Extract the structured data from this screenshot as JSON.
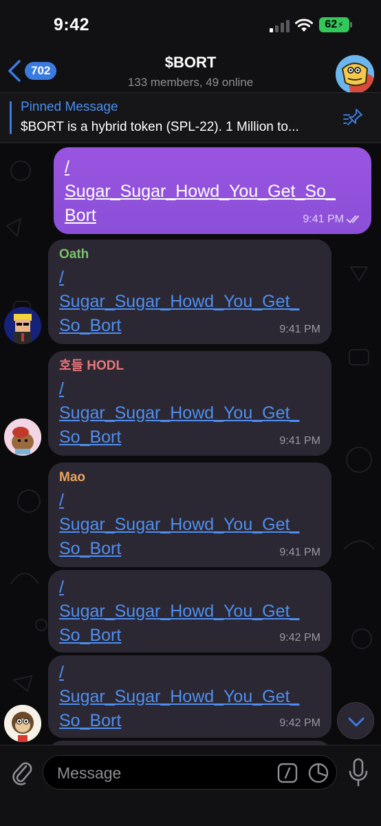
{
  "status_bar": {
    "time": "9:42",
    "battery": "62"
  },
  "header": {
    "back_count": "702",
    "title": "$BORT",
    "subtitle": "133 members, 49 online"
  },
  "pinned": {
    "title": "Pinned Message",
    "text": "$BORT is a hybrid token (SPL-22). 1 Million to..."
  },
  "messages": [
    {
      "direction": "outgoing",
      "sender": "",
      "text": "/\nSugar_Sugar_Howd_You_Get_So_\nBort",
      "time": "9:41 PM",
      "read": true
    },
    {
      "direction": "incoming",
      "sender": "Oath",
      "sender_color": "#7cc26a",
      "text": "/\nSugar_Sugar_Howd_You_Get_\nSo_Bort",
      "time": "9:41 PM"
    },
    {
      "direction": "incoming",
      "sender": "호들 HODL",
      "sender_color": "#e8767a",
      "text": "/\nSugar_Sugar_Howd_You_Get_\nSo_Bort",
      "time": "9:41 PM"
    },
    {
      "direction": "incoming",
      "sender": "Mao",
      "sender_color": "#e8a45c",
      "text": "/\nSugar_Sugar_Howd_You_Get_\nSo_Bort",
      "time": "9:41 PM"
    },
    {
      "direction": "incoming",
      "sender": "",
      "text": "/\nSugar_Sugar_Howd_You_Get_\nSo_Bort",
      "time": "9:42 PM"
    },
    {
      "direction": "incoming",
      "sender": "",
      "text": "/\nSugar_Sugar_Howd_You_Get_\nSo_Bort",
      "time": "9:42 PM"
    }
  ],
  "input": {
    "placeholder": "Message"
  },
  "colors": {
    "accent": "#3a7be0",
    "outgoing_bubble": "#8b4fd8",
    "incoming_bubble": "#2b2834",
    "link": "#4f8ff0"
  }
}
